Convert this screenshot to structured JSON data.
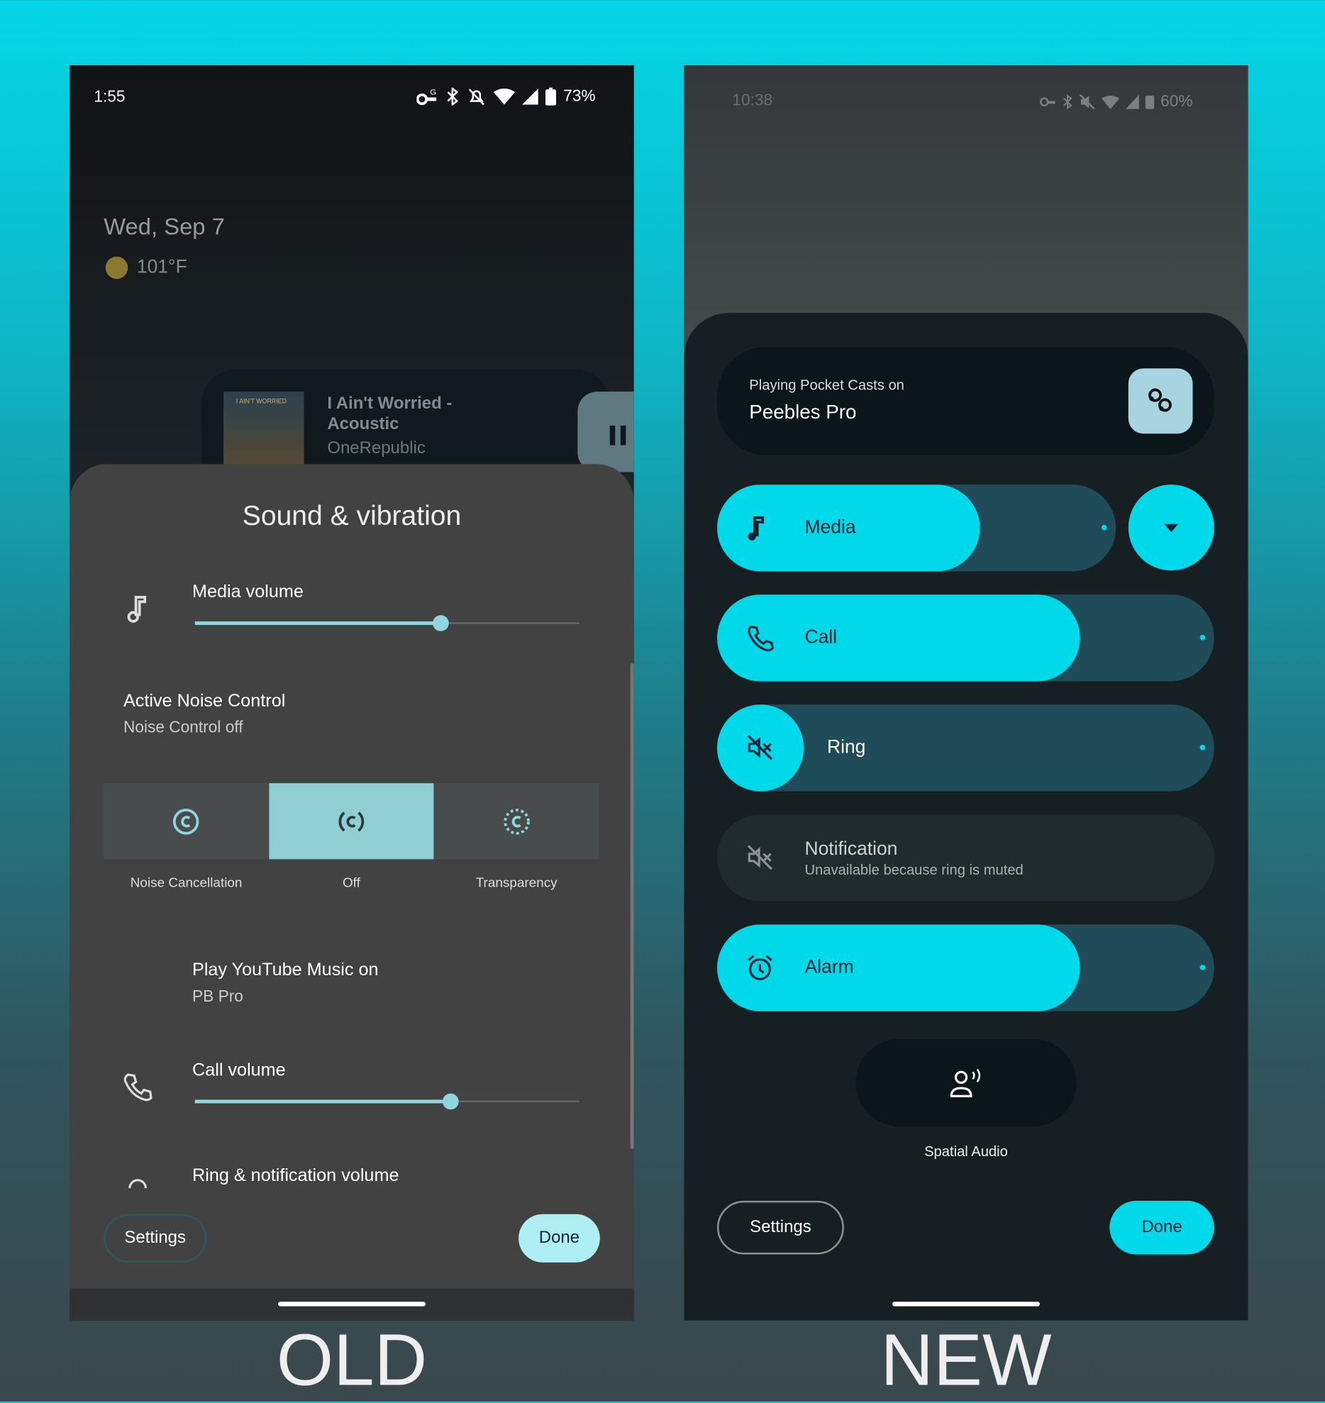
{
  "old": {
    "label": "OLD",
    "status": {
      "time": "1:55",
      "battery": "73%"
    },
    "lockscreen": {
      "date": "Wed, Sep 7",
      "temperature": "101°F"
    },
    "media_card": {
      "title_line1": "I Ain't Worried -",
      "title_line2": "Acoustic",
      "artist": "OneRepublic",
      "album_art_text": "I AIN'T WORRIED",
      "control": "pause-icon"
    },
    "sheet": {
      "title": "Sound & vibration",
      "media_volume": {
        "label": "Media volume",
        "value": 0.64
      },
      "anc": {
        "title": "Active Noise Control",
        "subtitle": "Noise Control off",
        "options": [
          {
            "label": "Noise Cancellation",
            "selected": false
          },
          {
            "label": "Off",
            "selected": true
          },
          {
            "label": "Transparency",
            "selected": false
          }
        ]
      },
      "output": {
        "title": "Play YouTube Music on",
        "device": "PB Pro"
      },
      "call_volume": {
        "label": "Call volume",
        "value": 0.665
      },
      "ring_volume": {
        "label": "Ring & notification volume"
      },
      "settings": "Settings",
      "done": "Done"
    },
    "colors": {
      "accent": "#8fd6de",
      "sheet": "#424242"
    }
  },
  "new": {
    "label": "NEW",
    "status": {
      "time": "10:38",
      "battery": "60%"
    },
    "cast": {
      "subtitle": "Playing Pocket Casts on",
      "device": "Peebles Pro",
      "icon": "earbuds-icon"
    },
    "sliders": [
      {
        "label": "Media",
        "icon": "music-note-icon",
        "value": 0.66
      },
      {
        "label": "Call",
        "icon": "phone-icon",
        "value": 0.73
      },
      {
        "label": "Ring",
        "icon": "ring-muted-icon",
        "value": 0
      },
      {
        "label": "Notification",
        "icon": "notification-muted-icon",
        "disabled": true,
        "subtitle": "Unavailable because ring is muted"
      },
      {
        "label": "Alarm",
        "icon": "alarm-icon",
        "value": 0.73
      }
    ],
    "spatial_audio": "Spatial Audio",
    "settings": "Settings",
    "done": "Done",
    "colors": {
      "accent": "#00d9ea",
      "track": "#1f4c58",
      "sheet": "#162022"
    }
  }
}
